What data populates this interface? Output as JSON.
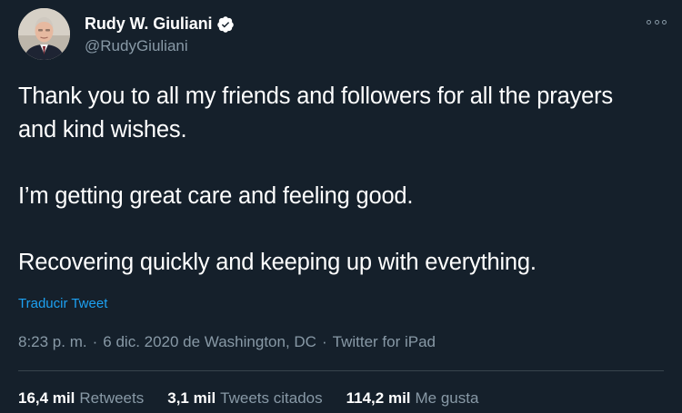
{
  "author": {
    "display_name": "Rudy W. Giuliani",
    "handle": "@RudyGiuliani",
    "verified": true,
    "avatar_icon": "profile-photo"
  },
  "tweet": {
    "paragraphs": [
      "Thank you to all my friends and followers for all the prayers and kind wishes.",
      "I’m getting great care and feeling good.",
      "Recovering quickly and keeping up with everything."
    ],
    "translate_label": "Traducir Tweet"
  },
  "meta": {
    "time": "8:23 p. m.",
    "separator": "·",
    "date_location": "6 dic. 2020 de Washington, DC",
    "source": "Twitter for iPad"
  },
  "stats": {
    "retweets_count": "16,4 mil",
    "retweets_label": "Retweets",
    "quotes_count": "3,1 mil",
    "quotes_label": "Tweets citados",
    "likes_count": "114,2 mil",
    "likes_label": "Me gusta"
  },
  "colors": {
    "background": "#15202b",
    "text": "#ffffff",
    "secondary": "#8899a6",
    "link": "#1da1f2",
    "divider": "#38444d"
  }
}
